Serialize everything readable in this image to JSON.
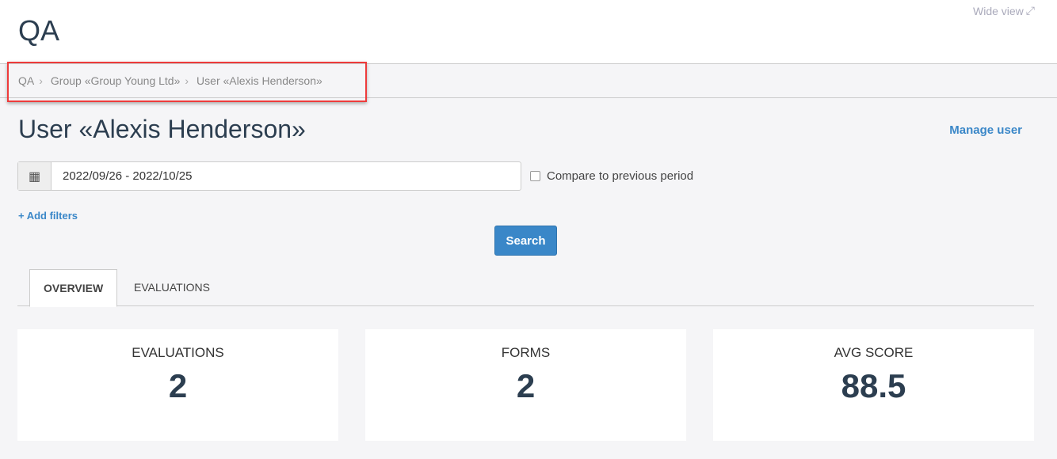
{
  "app": {
    "title": "QA",
    "wide_view": "Wide view"
  },
  "breadcrumb": [
    "QA",
    "Group «Group Young Ltd»",
    "User «Alexis Henderson»"
  ],
  "page": {
    "title": "User «Alexis Henderson»",
    "manage_user": "Manage user"
  },
  "filters": {
    "date_range": "2022/09/26 - 2022/10/25",
    "compare_label": "Compare to previous period",
    "compare_checked": false,
    "add_filters": "+ Add filters",
    "search": "Search"
  },
  "tabs": [
    {
      "label": "OVERVIEW",
      "active": true
    },
    {
      "label": "EVALUATIONS",
      "active": false
    }
  ],
  "cards": [
    {
      "label": "EVALUATIONS",
      "value": "2"
    },
    {
      "label": "FORMS",
      "value": "2"
    },
    {
      "label": "AVG SCORE",
      "value": "88.5"
    }
  ],
  "colors": {
    "accent": "#3a87c8",
    "highlight": "#ee3b3b"
  }
}
